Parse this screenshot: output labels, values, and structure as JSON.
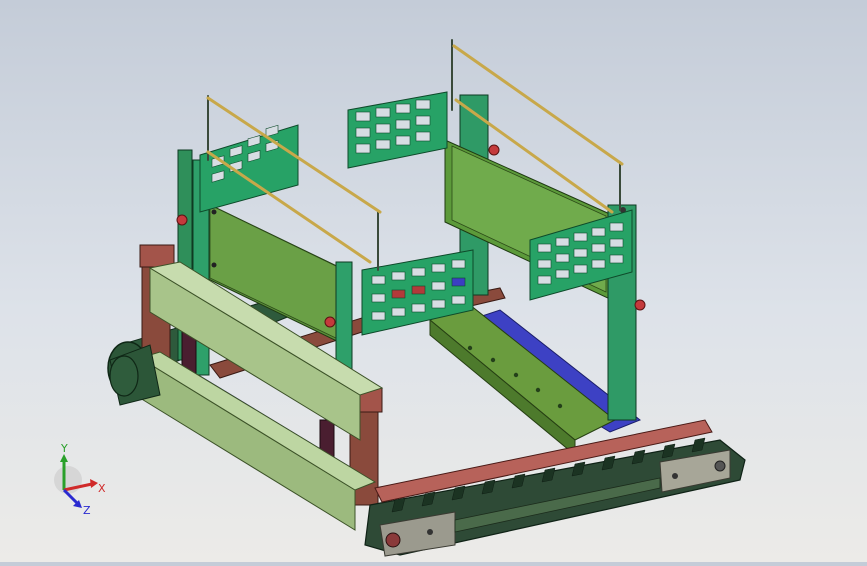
{
  "viewport": {
    "background_top": "#c4ccd8",
    "background_bottom": "#ecebe8"
  },
  "model": {
    "colors": {
      "frame_green": "#5f8a47",
      "frame_green_light": "#7fa85f",
      "panel_green": "#2e9a6a",
      "panel_green_dark": "#1f7a50",
      "rail_blue": "#3a3fc0",
      "track_dark": "#2e4a35",
      "track_red": "#b5605a",
      "post_brown": "#7a3a33",
      "bolt_red": "#c0393b",
      "rod_gold": "#c8a84a"
    }
  },
  "triad": {
    "y_label": "Y",
    "x_label": "X",
    "z_label": "Z",
    "y_color": "#2aa02a",
    "x_color": "#d02a2a",
    "z_color": "#2a2ad0"
  }
}
